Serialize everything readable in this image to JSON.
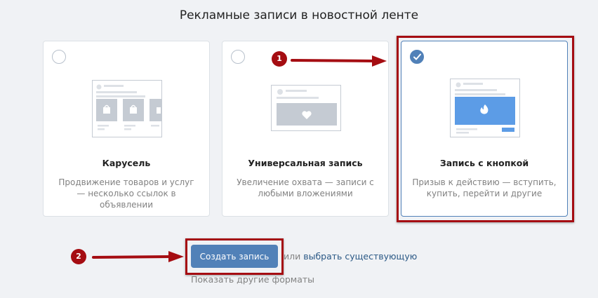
{
  "page": {
    "title": "Рекламные записи в новостной ленте"
  },
  "cards": [
    {
      "title": "Карусель",
      "description": "Продвижение товаров и услуг — несколько ссылок в объявлении",
      "selected": false
    },
    {
      "title": "Универсальная запись",
      "description": "Увеличение охвата — записи с любыми вложениями",
      "selected": false
    },
    {
      "title": "Запись с кнопкой",
      "description": "Призыв к действию — вступить, купить, перейти и другие",
      "selected": true
    }
  ],
  "actions": {
    "create_label": "Создать запись",
    "or_text": "или ",
    "choose_existing_label": "выбрать существующую",
    "other_formats_label": "Показать другие форматы"
  },
  "annotations": {
    "step1": "1",
    "step2": "2"
  },
  "colors": {
    "accent": "#5181b8",
    "highlight": "#a50d12",
    "link": "#2a5885"
  }
}
